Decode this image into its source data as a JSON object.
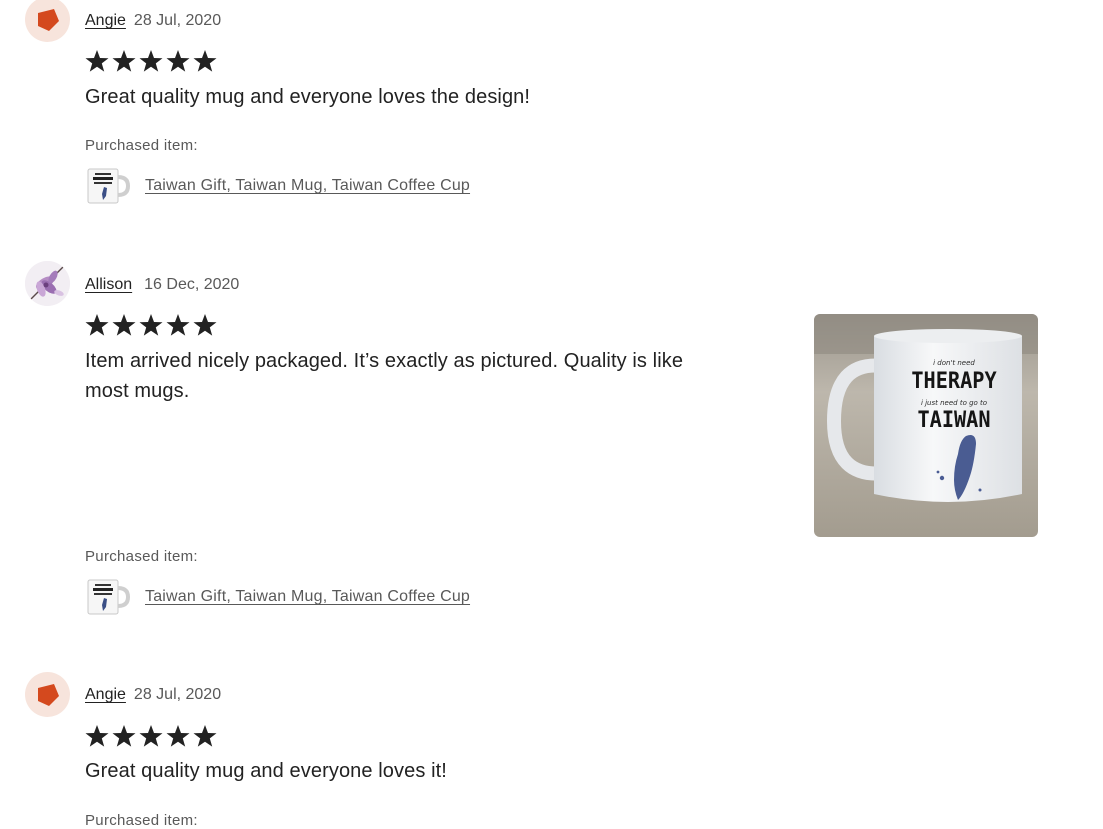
{
  "reviews": [
    {
      "author": "Angie",
      "date": "28 Jul, 2020",
      "rating": 5,
      "text": "Great quality mug and everyone loves the design!",
      "purchased_label": "Purchased item:",
      "item_title": "Taiwan Gift, Taiwan Mug, Taiwan Coffee Cup",
      "avatar_icon": "orange-pentagon-avatar"
    },
    {
      "author": "Allison",
      "date": "16 Dec, 2020",
      "rating": 5,
      "text": "Item arrived nicely packaged. It’s exactly as pictured. Quality is like most mugs.",
      "purchased_label": "Purchased item:",
      "item_title": "Taiwan Gift, Taiwan Mug, Taiwan Coffee Cup",
      "avatar_icon": "flower-avatar",
      "photo": {
        "line1": "i don't need",
        "line2": "THERAPY",
        "line3": "i just need to go to",
        "line4": "TAIWAN"
      }
    },
    {
      "author": "Angie",
      "date": "28 Jul, 2020",
      "rating": 5,
      "text": "Great quality mug and everyone loves it!",
      "purchased_label": "Purchased item:",
      "avatar_icon": "orange-pentagon-avatar"
    }
  ],
  "colors": {
    "star": "#222222",
    "avatar_orange": "#d4491e",
    "avatar_bg": "#f7e4dc",
    "muted_text": "#595959"
  }
}
